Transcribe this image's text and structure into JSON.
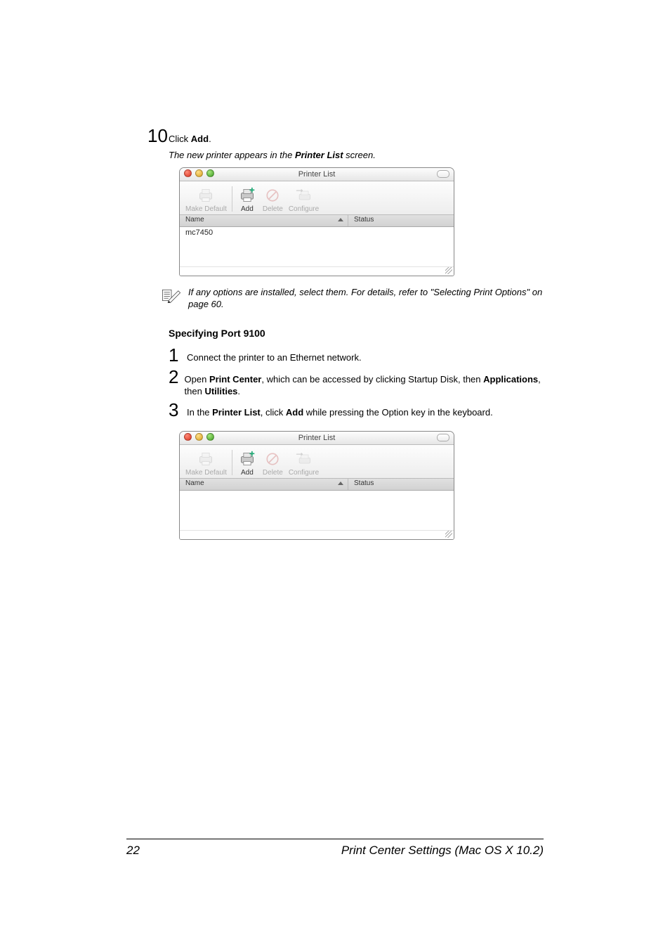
{
  "step10": {
    "number": "10",
    "prefix": "Click ",
    "bold": "Add",
    "suffix": ".",
    "sub_prefix": "The new printer appears in the ",
    "sub_bold": "Printer List",
    "sub_suffix": " screen."
  },
  "printer_list": {
    "title": "Printer List",
    "toolbar": {
      "make_default": "Make Default",
      "add": "Add",
      "delete": "Delete",
      "configure": "Configure"
    },
    "columns": {
      "name": "Name",
      "status": "Status"
    },
    "rows_with_printer": [
      "mc7450"
    ],
    "rows_empty": []
  },
  "note": {
    "text": "If any options are installed, select them. For details, refer to \"Selecting Print Options\" on page 60."
  },
  "section_heading": "Specifying Port 9100",
  "steps": {
    "s1": {
      "num": "1",
      "txt": "Connect the printer to an Ethernet network."
    },
    "s2": {
      "num": "2",
      "p1": "Open ",
      "b1": "Print Center",
      "p2": ", which can be accessed by clicking Startup Disk, then ",
      "b2": "Applications",
      "p3": ", then ",
      "b3": "Utilities",
      "p4": "."
    },
    "s3": {
      "num": "3",
      "p1": "In the ",
      "b1": "Printer List",
      "p2": ", click ",
      "b2": "Add",
      "p3": " while pressing the Option key in the keyboard."
    }
  },
  "footer": {
    "page": "22",
    "title": "Print Center Settings (Mac OS X 10.2)"
  }
}
